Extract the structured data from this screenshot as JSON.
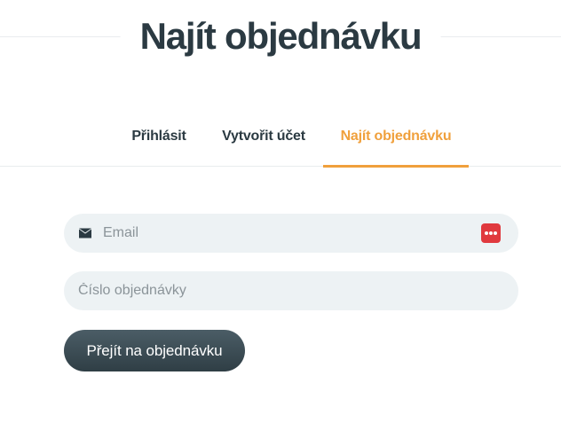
{
  "header": {
    "title": "Najít objednávku"
  },
  "tabs": [
    {
      "label": "Přihlásit",
      "active": false
    },
    {
      "label": "Vytvořit účet",
      "active": false
    },
    {
      "label": "Najít objednávku",
      "active": true
    }
  ],
  "form": {
    "email": {
      "value": "",
      "placeholder": "Email",
      "icon": "envelope-icon",
      "password_manager_icon": "password-manager-icon"
    },
    "order_number": {
      "value": "",
      "placeholder": "Číslo objednávky"
    },
    "submit_label": "Přejít na objednávku"
  },
  "colors": {
    "accent": "#f0a03c",
    "text_dark": "#2b3a42",
    "field_bg": "#edf2f4",
    "button_bg": "#3a4a52",
    "password_manager": "#e0393e"
  }
}
